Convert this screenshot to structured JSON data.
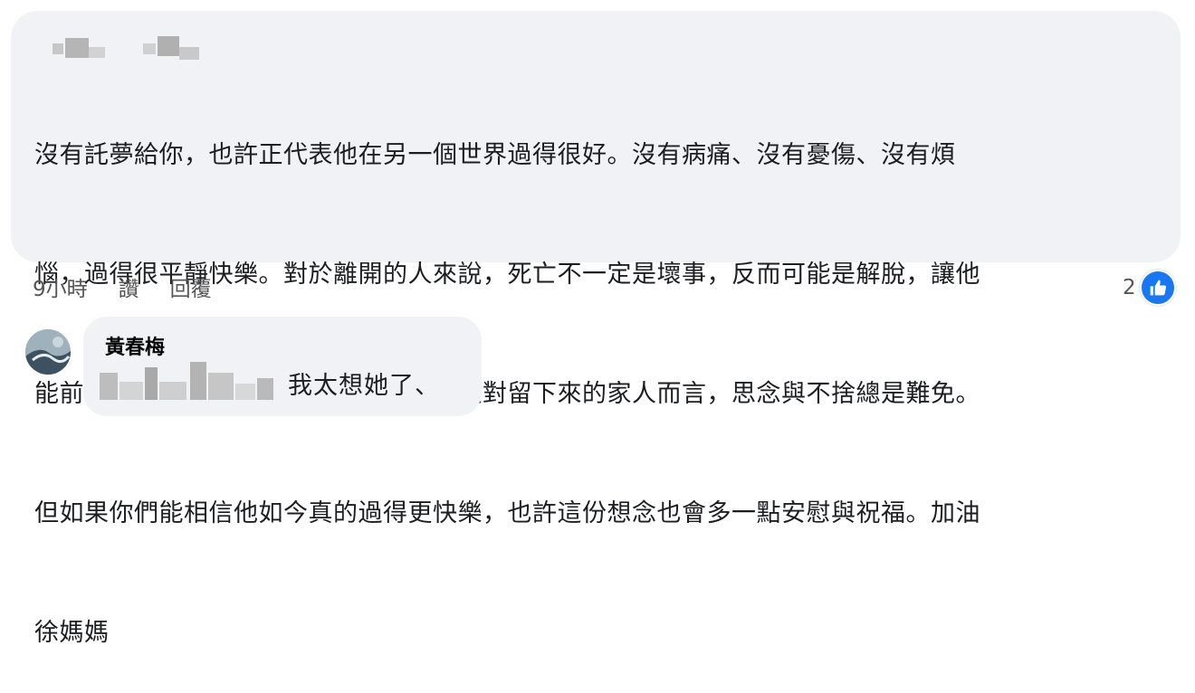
{
  "comment": {
    "lines": [
      "沒有託夢給你，也許正代表他在另一個世界過得很好。沒有病痛、沒有憂傷、沒有煩",
      "惱，過得很平靜快樂。對於離開的人來說，死亡不一定是壞事，反而可能是解脫，讓他",
      "能前往一個更自在、更幸福的地方。只是對留下來的家人而言，思念與不捨總是難免。",
      "但如果你們能相信他如今真的過得更快樂，也許這份想念也會多一點安慰與祝福。加油",
      "徐媽媽"
    ],
    "time": "9小時",
    "like_label": "讚",
    "reply_label": "回覆",
    "reaction_count": "2",
    "reaction_icon": "thumbs-up-icon",
    "reaction_color": "#1877f2"
  },
  "reply": {
    "author": "黃春梅",
    "text": "我太想她了、"
  }
}
